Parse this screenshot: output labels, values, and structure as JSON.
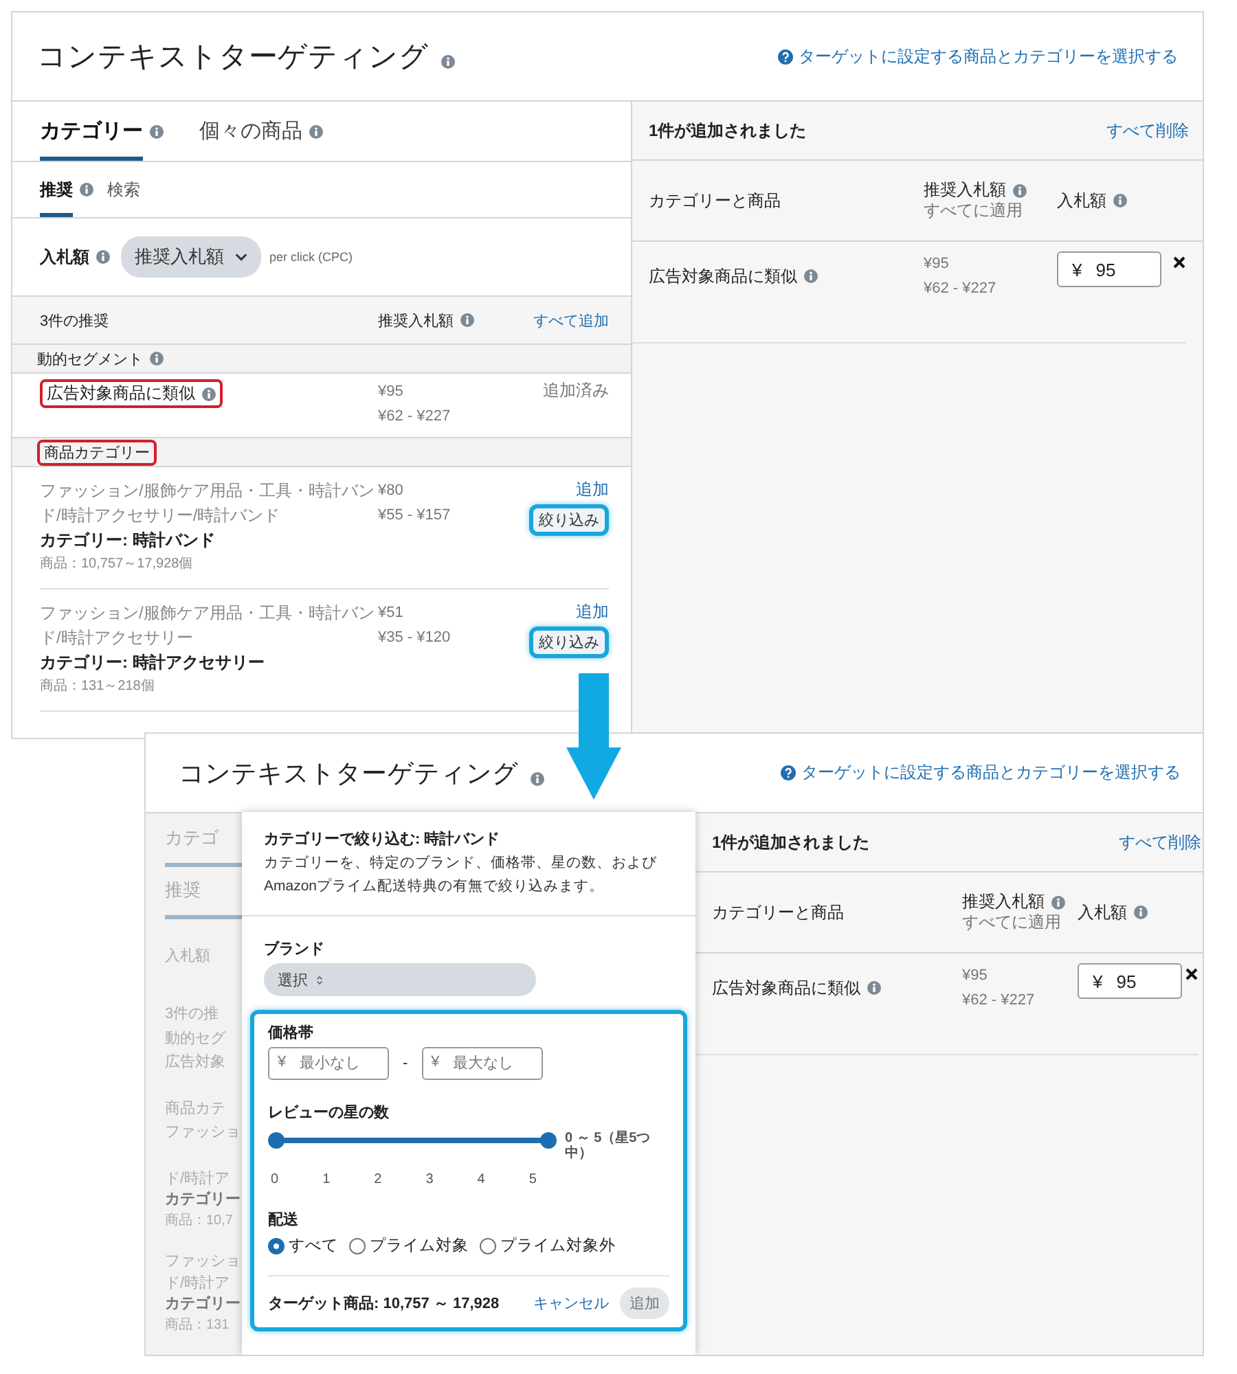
{
  "top_screen": {
    "title": "コンテキストターゲティング",
    "help_link": "ターゲットに設定する商品とカテゴリーを選択する",
    "tabs": [
      {
        "label": "カテゴリー",
        "selected": true
      },
      {
        "label": "個々の商品",
        "selected": false
      }
    ],
    "subtabs": [
      {
        "label": "推奨",
        "selected": true
      },
      {
        "label": "検索",
        "selected": false
      }
    ],
    "bid": {
      "label": "入札額",
      "dropdown": "推奨入札額",
      "unit": "per click (CPC)"
    },
    "list_header": {
      "count": "3件の推奨",
      "bid_column": "推奨入札額",
      "add_all": "すべて追加"
    },
    "sections": [
      {
        "title": "動的セグメント",
        "highlighted": false,
        "items": [
          {
            "kind": "segment",
            "name": "広告対象商品に類似",
            "highlighted": true,
            "bid": "¥95",
            "range": "¥62 - ¥227",
            "status": "追加済み"
          }
        ]
      },
      {
        "title": "商品カテゴリー",
        "highlighted": true,
        "items": [
          {
            "kind": "category",
            "path": "ファッション/服飾ケア用品・工具・時計バンド/時計アクセサリー/時計バンド",
            "category": "カテゴリー: 時計バンド",
            "count": "商品：10,757～17,928個",
            "bid": "¥80",
            "range": "¥55 - ¥157",
            "add": "追加",
            "refine": "絞り込み",
            "highlighted": true
          },
          {
            "kind": "category",
            "path": "ファッション/服飾ケア用品・工具・時計バンド/時計アクセサリー",
            "category": "カテゴリー: 時計アクセサリー",
            "count": "商品：131～218個",
            "bid": "¥51",
            "range": "¥35 - ¥120",
            "add": "追加",
            "refine": "絞り込み",
            "highlighted": true
          }
        ]
      }
    ],
    "added": {
      "title": "1件が追加されました",
      "remove_all": "すべて削除",
      "columns": {
        "name": "カテゴリーと商品",
        "suggested": "推奨入札額",
        "suggested_sub": "すべてに適用",
        "bid": "入札額"
      },
      "rows": [
        {
          "name": "広告対象商品に類似",
          "bid": "¥95",
          "range": "¥62 - ¥227",
          "currency": "¥",
          "value": "95"
        }
      ]
    }
  },
  "bottom_screen": {
    "title": "コンテキストターゲティング",
    "help_link": "ターゲットに設定する商品とカテゴリーを選択する",
    "covered_column": [
      {
        "kind": "tab",
        "text": "カテゴ"
      },
      {
        "kind": "tab",
        "text": "推奨"
      },
      {
        "kind": "label",
        "text": "入札額"
      },
      {
        "kind": "header",
        "text": "3件の推"
      },
      {
        "kind": "section",
        "text": "動的セグ"
      },
      {
        "kind": "row",
        "text": "広告対象"
      },
      {
        "kind": "section",
        "text": "商品カテ"
      },
      {
        "kind": "row",
        "text": "ファッショ"
      },
      {
        "kind": "row",
        "text": "ド/時計ア"
      },
      {
        "kind": "bold",
        "text": "カテゴリー"
      },
      {
        "kind": "meta",
        "text": "商品：10,7"
      },
      {
        "kind": "row",
        "text": "ファッショ"
      },
      {
        "kind": "row",
        "text": "ド/時計ア"
      },
      {
        "kind": "bold",
        "text": "カテゴリー"
      },
      {
        "kind": "meta",
        "text": "商品：131"
      }
    ],
    "filter_popover": {
      "title": "カテゴリーで絞り込む: 時計バンド",
      "description": "カテゴリーを、特定のブランド、価格帯、星の数、およびAmazonプライム配送特典の有無で絞り込みます。",
      "brand": {
        "label": "ブランド",
        "select": "選択"
      },
      "highlighted": true,
      "price": {
        "label": "価格帯",
        "currency": "¥",
        "min_placeholder": "最小なし",
        "max_placeholder": "最大なし",
        "separator": "-"
      },
      "rating": {
        "label": "レビューの星の数",
        "level": 1,
        "reading": "0 ～ 5（星5つ中）",
        "ticks": [
          "0",
          "1",
          "2",
          "3",
          "4",
          "5"
        ]
      },
      "delivery": {
        "label": "配送",
        "options": [
          {
            "label": "すべて",
            "selected": true
          },
          {
            "label": "プライム対象",
            "selected": false
          },
          {
            "label": "プライム対象外",
            "selected": false
          }
        ]
      },
      "footer": {
        "target": "ターゲット商品: 10,757 ～ 17,928",
        "cancel": "キャンセル",
        "add": "追加"
      }
    },
    "added": {
      "title": "1件が追加されました",
      "remove_all": "すべて削除",
      "columns": {
        "name": "カテゴリーと商品",
        "suggested": "推奨入札額",
        "suggested_sub": "すべてに適用",
        "bid": "入札額"
      },
      "rows": [
        {
          "name": "広告対象商品に類似",
          "bid": "¥95",
          "range": "¥62 - ¥227",
          "currency": "¥",
          "value": "95"
        }
      ]
    }
  }
}
